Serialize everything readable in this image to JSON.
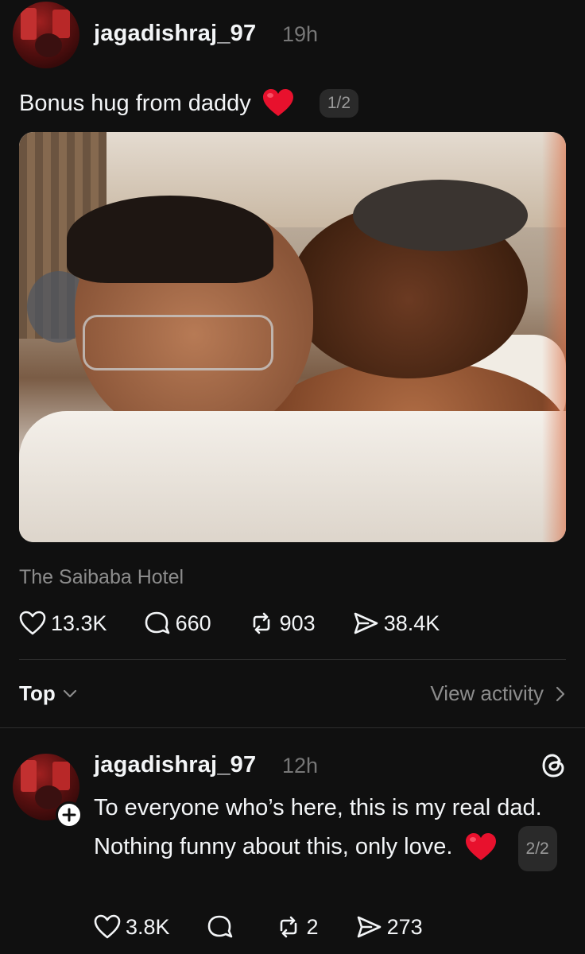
{
  "post1": {
    "username": "jagadishraj_97",
    "time": "19h",
    "caption": "Bonus hug from daddy",
    "pager": "1/2",
    "location": "The Saibaba Hotel",
    "stats": {
      "likes": "13.3K",
      "replies": "660",
      "reposts": "903",
      "shares": "38.4K"
    }
  },
  "replies_bar": {
    "sort_label": "Top",
    "view_activity_label": "View activity"
  },
  "post2": {
    "username": "jagadishraj_97",
    "time": "12h",
    "text": "To everyone who’s here, this is my real dad. Nothing funny about this, only love.",
    "pager": "2/2",
    "stats": {
      "likes": "3.8K",
      "replies": "",
      "reposts": "2",
      "shares": "273"
    }
  },
  "colors": {
    "background": "#101010",
    "text_primary": "#f3f5f7",
    "text_secondary": "#8c8c8c",
    "heart_emoji": "#e8112d"
  },
  "icons": [
    "heart-icon",
    "comment-icon",
    "repost-icon",
    "share-icon",
    "chevron-down-icon",
    "chevron-right-icon",
    "threads-icon",
    "plus-icon"
  ]
}
